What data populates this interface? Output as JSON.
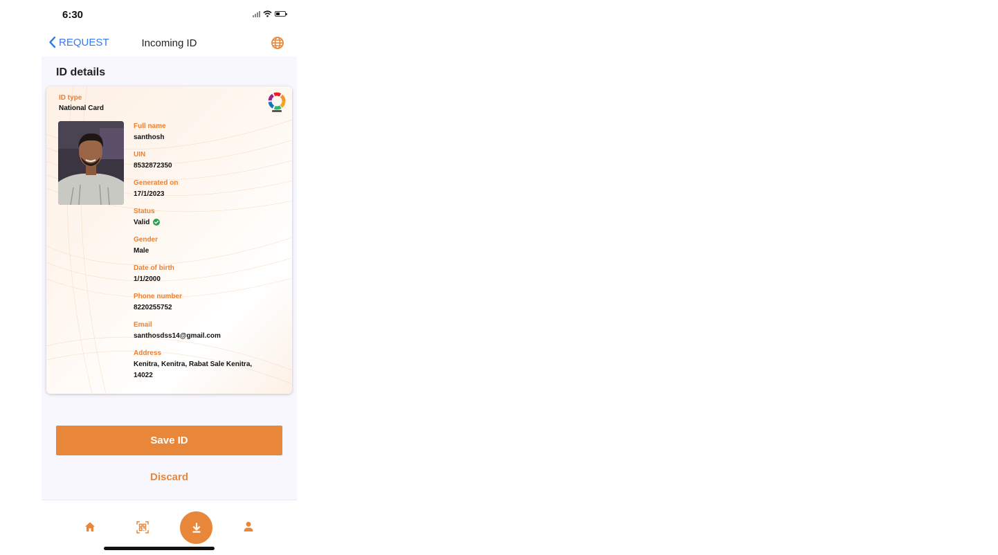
{
  "status_bar": {
    "time": "6:30"
  },
  "nav": {
    "back_label": "REQUEST",
    "title": "Incoming ID"
  },
  "section_title": "ID details",
  "card": {
    "id_type_label": "ID type",
    "id_type": "National Card",
    "fields": {
      "full_name": {
        "label": "Full name",
        "value": "santhosh"
      },
      "uin": {
        "label": "UIN",
        "value": "8532872350"
      },
      "generated_on": {
        "label": "Generated on",
        "value": "17/1/2023"
      },
      "status": {
        "label": "Status",
        "value": "Valid"
      },
      "gender": {
        "label": "Gender",
        "value": "Male"
      },
      "dob": {
        "label": "Date of birth",
        "value": "1/1/2000"
      },
      "phone": {
        "label": "Phone number",
        "value": "8220255752"
      },
      "email": {
        "label": "Email",
        "value": "santhosdss14@gmail.com"
      },
      "address": {
        "label": "Address",
        "line1": "Kenitra, Kenitra, Rabat Sale Kenitra,",
        "line2": "14022"
      }
    }
  },
  "actions": {
    "save": "Save ID",
    "discard": "Discard"
  },
  "icons": {
    "back": "chevron-left-icon",
    "language": "globe-icon",
    "logo": "mosip-logo",
    "status_check": "check-circle-icon",
    "tabs": [
      "home-icon",
      "qr-scan-icon",
      "download-icon",
      "profile-icon"
    ]
  },
  "colors": {
    "accent": "#e8873a",
    "label": "#ed7f2f",
    "link": "#3478f6",
    "valid": "#2e9e4f",
    "background": "#f7f7fd"
  }
}
